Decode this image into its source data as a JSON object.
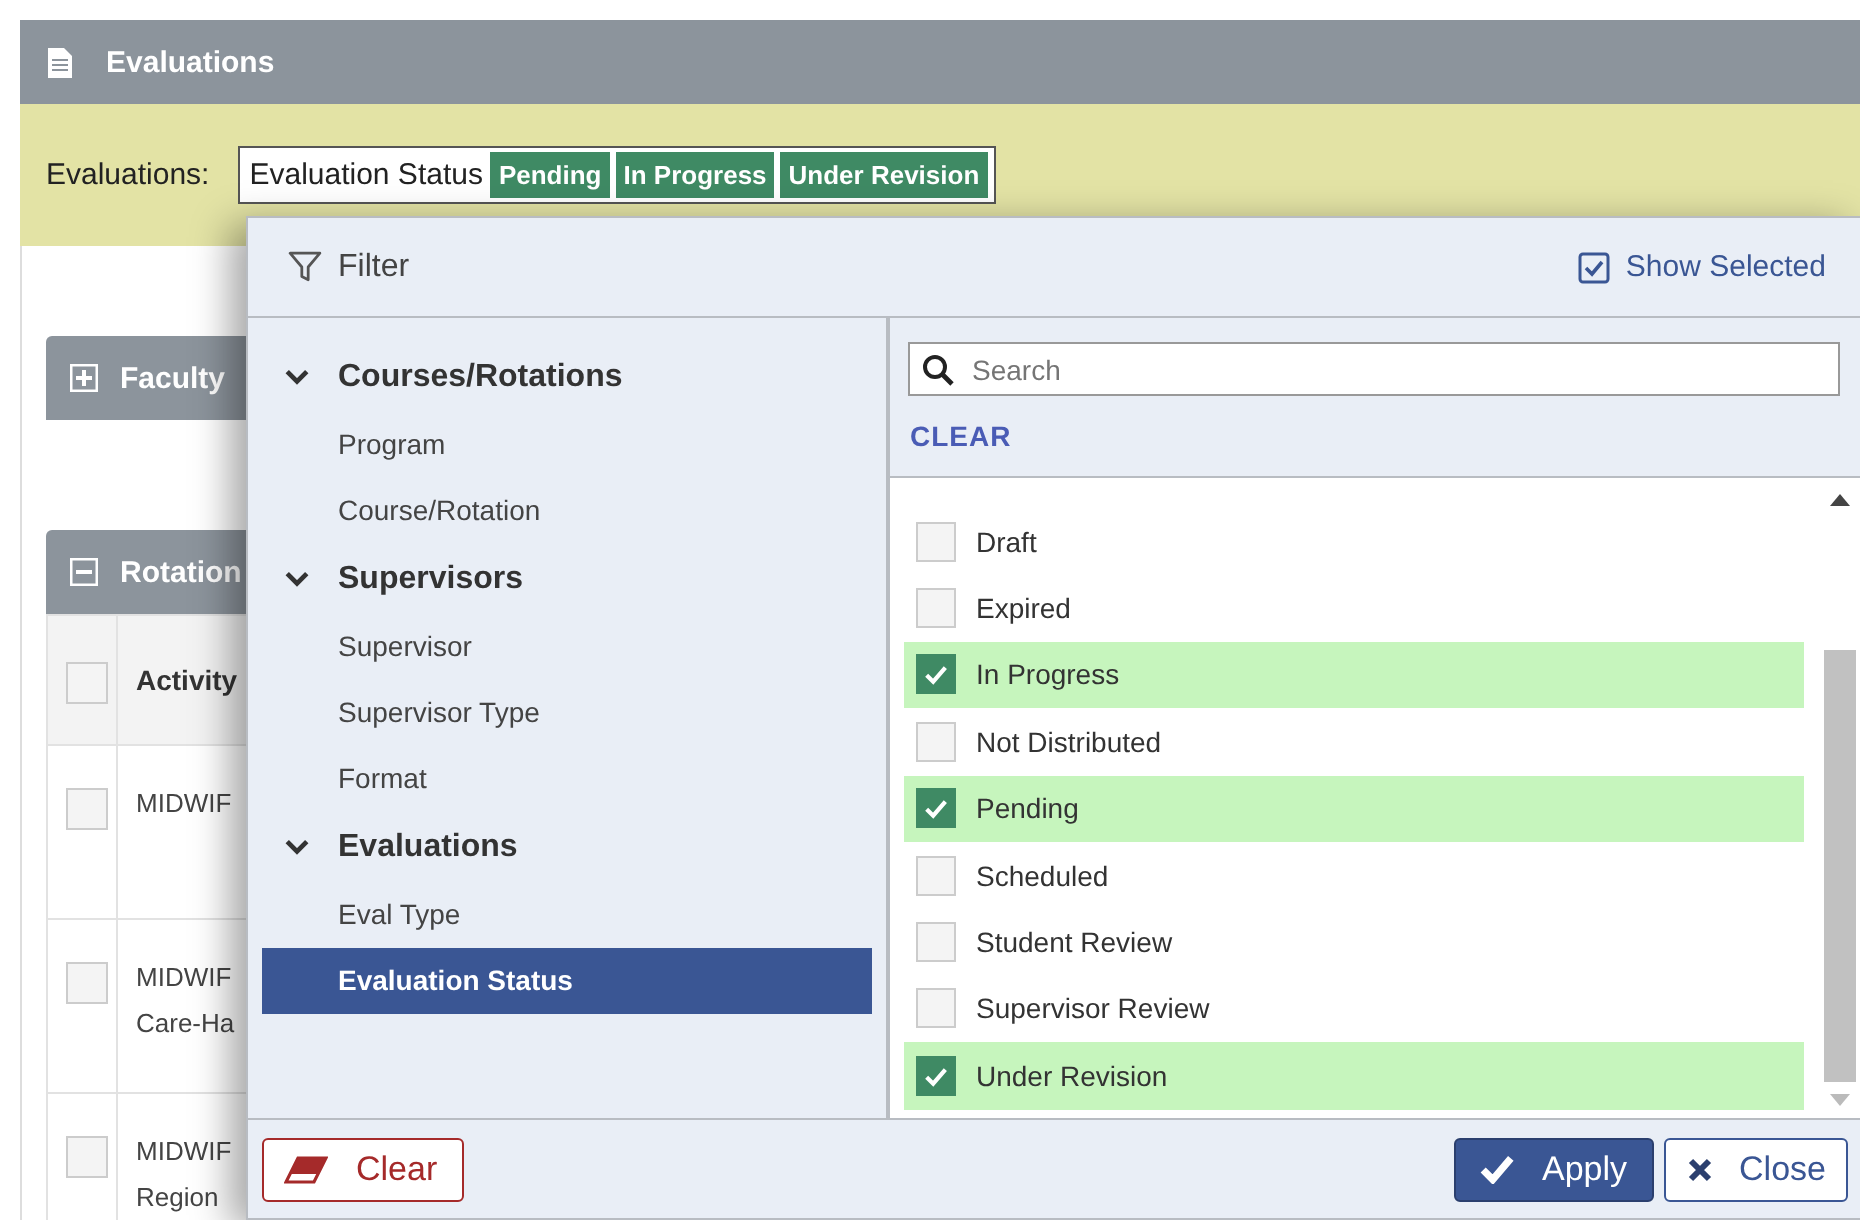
{
  "header": {
    "title": "Evaluations"
  },
  "filter_bar": {
    "label": "Evaluations:",
    "field": "Evaluation Status",
    "chips": [
      "Pending",
      "In Progress",
      "Under Revision"
    ]
  },
  "panels": [
    {
      "title": "Faculty",
      "expanded": false
    },
    {
      "title": "Rotation",
      "expanded": true
    }
  ],
  "table": {
    "select_all_checked": false,
    "columns": [
      "Activity"
    ],
    "rows": [
      {
        "checked": false,
        "lines": [
          "MIDWIF"
        ]
      },
      {
        "checked": false,
        "lines": [
          "MIDWIF",
          "Care-Ha"
        ]
      },
      {
        "checked": false,
        "lines": [
          "MIDWIF",
          "Region"
        ]
      }
    ]
  },
  "filter_popup": {
    "title": "Filter",
    "show_selected": {
      "label": "Show Selected",
      "checked": true
    },
    "groups": [
      {
        "label": "Courses/Rotations",
        "expanded": true,
        "children": [
          {
            "label": "Program",
            "selected": false
          },
          {
            "label": "Course/Rotation",
            "selected": false
          }
        ]
      },
      {
        "label": "Supervisors",
        "expanded": true,
        "children": [
          {
            "label": "Supervisor",
            "selected": false
          },
          {
            "label": "Supervisor Type",
            "selected": false
          },
          {
            "label": "Format",
            "selected": false
          }
        ]
      },
      {
        "label": "Evaluations",
        "expanded": true,
        "children": [
          {
            "label": "Eval Type",
            "selected": false
          },
          {
            "label": "Evaluation Status",
            "selected": true
          }
        ]
      }
    ],
    "search": {
      "placeholder": "Search"
    },
    "clear_link": "CLEAR",
    "options": [
      {
        "label": "Draft",
        "checked": false
      },
      {
        "label": "Expired",
        "checked": false
      },
      {
        "label": "In Progress",
        "checked": true
      },
      {
        "label": "Not Distributed",
        "checked": false
      },
      {
        "label": "Pending",
        "checked": true
      },
      {
        "label": "Scheduled",
        "checked": false
      },
      {
        "label": "Student Review",
        "checked": false
      },
      {
        "label": "Supervisor Review",
        "checked": false
      },
      {
        "label": "Under Revision",
        "checked": true
      }
    ],
    "clear_button": "Clear",
    "apply_button": "Apply",
    "close_button": "Close"
  }
}
